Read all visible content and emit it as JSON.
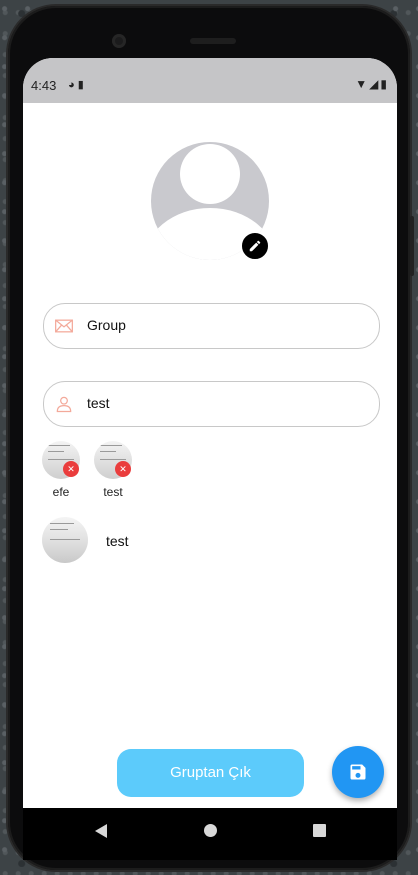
{
  "status_bar": {
    "time": "4:43"
  },
  "profile": {
    "avatar_icon": "person-placeholder-icon",
    "edit_icon": "pencil-icon"
  },
  "form": {
    "group_name": {
      "value": "Group",
      "icon": "mail-icon"
    },
    "member_search": {
      "value": "test",
      "icon": "person-outline-icon"
    }
  },
  "selected_members": [
    {
      "name": "efe",
      "remove_icon": "close-icon"
    },
    {
      "name": "test",
      "remove_icon": "close-icon"
    }
  ],
  "search_results": [
    {
      "name": "test"
    }
  ],
  "actions": {
    "leave_group_label": "Gruptan Çık",
    "save_icon": "save-icon"
  },
  "colors": {
    "accent": "#2196f3",
    "leave_button": "#5ccbfb",
    "remove_badge": "#ea3d3d",
    "field_icon": "#f3a99a"
  }
}
